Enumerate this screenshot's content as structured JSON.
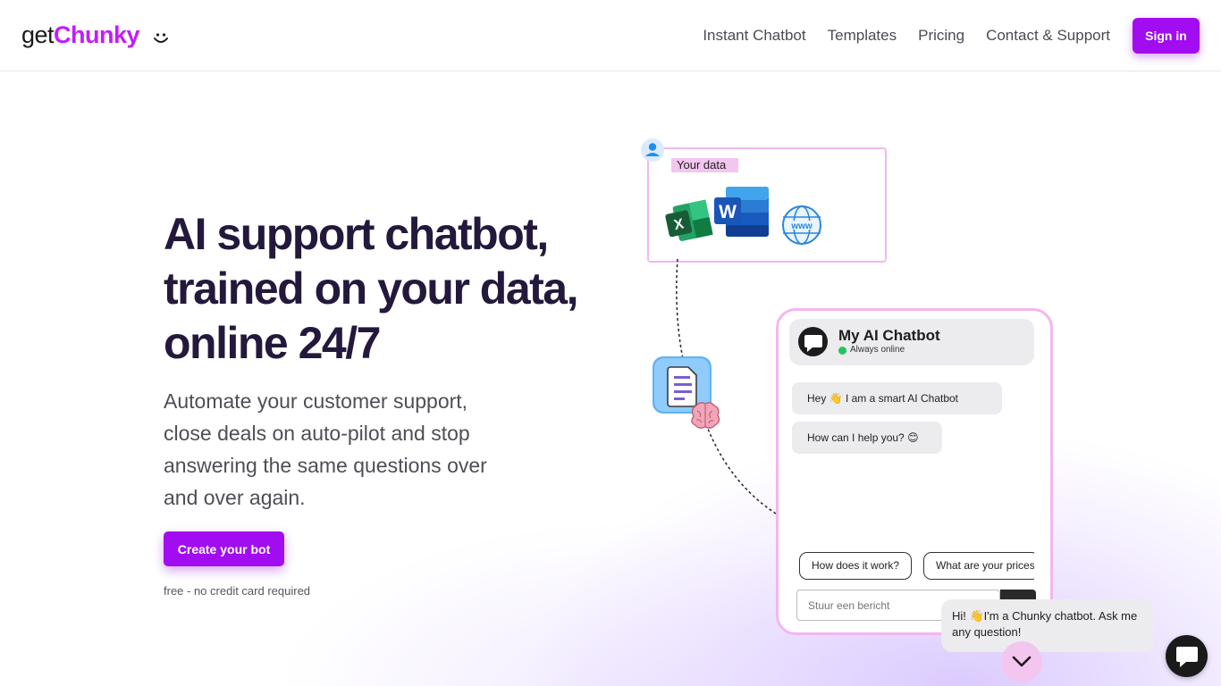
{
  "header": {
    "logo_get": "get",
    "logo_chunky": "Chunky",
    "nav": [
      "Instant Chatbot",
      "Templates",
      "Pricing",
      "Contact & Support"
    ],
    "signin_label": "Sign in"
  },
  "hero": {
    "title_lines": [
      "AI support chatbot,",
      "trained on your data,",
      "online 24/7"
    ],
    "subtitle": "Automate your customer support, close deals on auto-pilot and stop answering the same questions over and over again.",
    "cta_label": "Create your bot",
    "cta_note": "free - no credit card required"
  },
  "illustration": {
    "data_label": "Your data",
    "sources": [
      "excel-icon",
      "word-icon",
      "globe-icon"
    ]
  },
  "chatbot": {
    "name": "My AI Chatbot",
    "status": "Always online",
    "messages": [
      "Hey 👋 I am a smart AI Chatbot",
      "How can I help you? 😊"
    ],
    "suggestions": [
      "How does it work?",
      "What are your prices?"
    ],
    "input_placeholder": "Stuur een bericht"
  },
  "widget": {
    "bubble_text": "Hi! 👋I'm a Chunky chatbot. Ask me any question!"
  },
  "colors": {
    "brand": "#a20cf0",
    "logo_accent": "#c21cff",
    "title": "#24193c",
    "card_border": "#f0b8f2",
    "online": "#22c55e"
  }
}
